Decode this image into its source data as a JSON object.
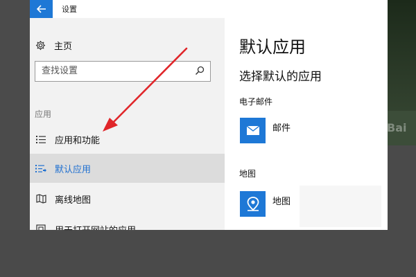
{
  "window": {
    "title": "设置"
  },
  "nav": {
    "home_label": "主页",
    "search_placeholder": "查找设置",
    "section_label": "应用",
    "items": [
      {
        "label": "应用和功能",
        "icon": "list-icon",
        "selected": false
      },
      {
        "label": "默认应用",
        "icon": "default-apps-icon",
        "selected": true
      },
      {
        "label": "离线地图",
        "icon": "map-icon",
        "selected": false
      },
      {
        "label": "用于打开网站的应用",
        "icon": "website-apps-icon",
        "selected": false
      }
    ]
  },
  "content": {
    "title": "默认应用",
    "subtitle": "选择默认的应用",
    "sections": [
      {
        "category": "电子邮件",
        "app_name": "邮件",
        "icon": "mail-icon"
      },
      {
        "category": "地图",
        "app_name": "地图",
        "icon": "maps-pin-icon"
      }
    ]
  },
  "colors": {
    "accent": "#1e78d6",
    "arrow": "#e0262a",
    "selected_bg": "#dcdcdc",
    "nav_bg": "#f2f2f2"
  }
}
